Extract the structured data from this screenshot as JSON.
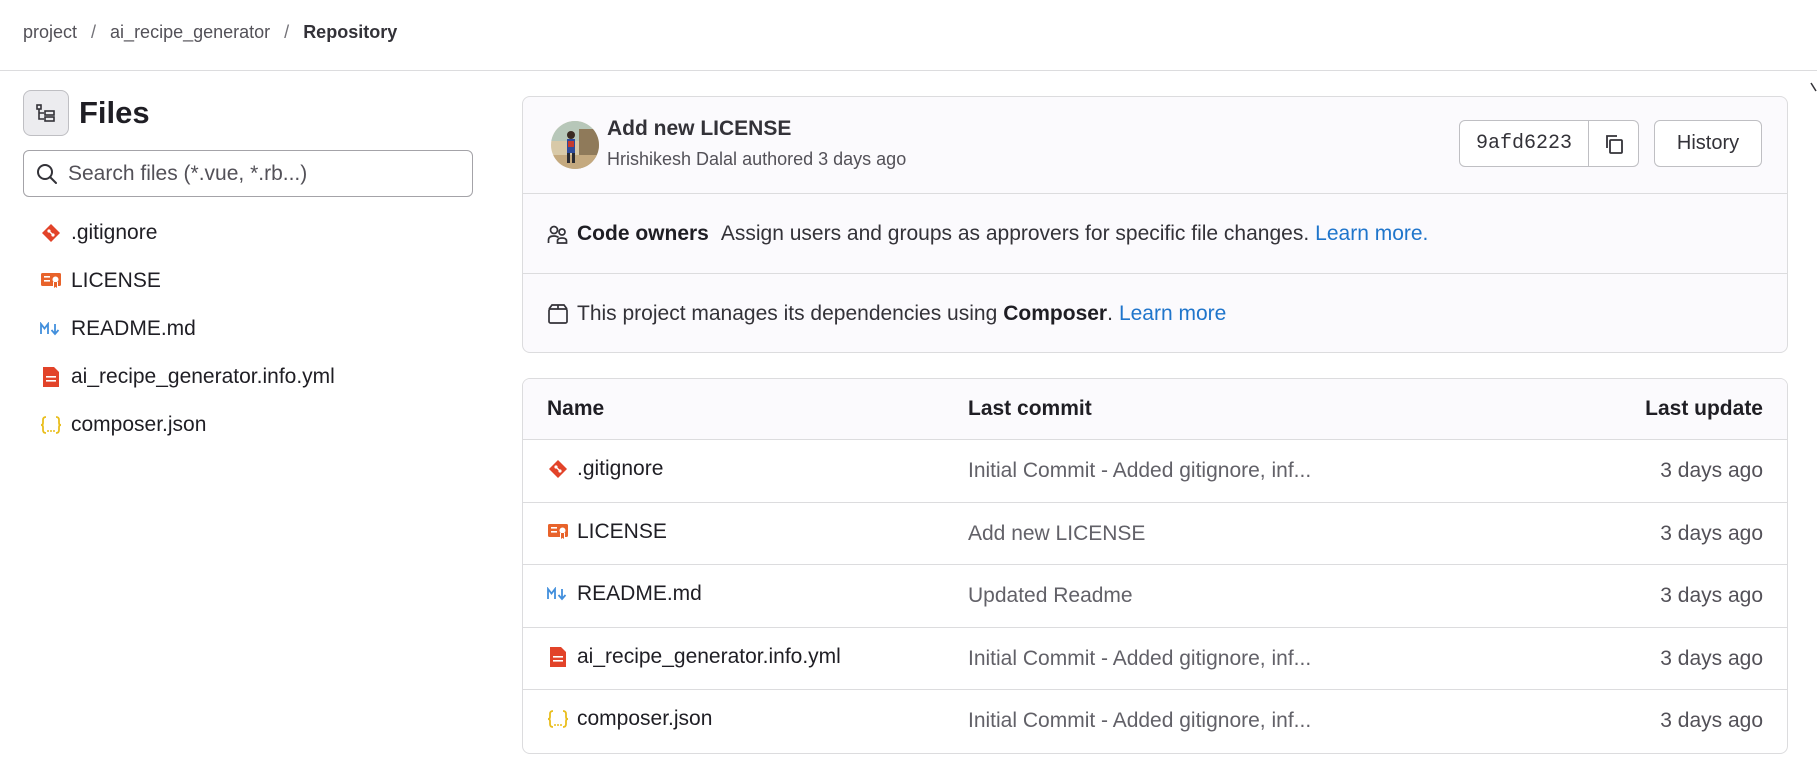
{
  "breadcrumb": {
    "items": [
      "project",
      "ai_recipe_generator",
      "Repository"
    ],
    "separator": "/"
  },
  "sidebar": {
    "title": "Files",
    "search": {
      "placeholder": "Search files (*.vue, *.rb...)",
      "value": ""
    },
    "files": [
      {
        "name": ".gitignore",
        "icon": "git-icon"
      },
      {
        "name": "LICENSE",
        "icon": "license-icon"
      },
      {
        "name": "README.md",
        "icon": "markdown-icon"
      },
      {
        "name": "ai_recipe_generator.info.yml",
        "icon": "yaml-file-icon"
      },
      {
        "name": "composer.json",
        "icon": "json-braces-icon"
      }
    ]
  },
  "commit": {
    "title": "Add new LICENSE",
    "author": "Hrishikesh Dalal",
    "action": "authored",
    "time": "3 days ago",
    "sha": "9afd6223",
    "history_label": "History"
  },
  "code_owners": {
    "label": "Code owners",
    "description": "Assign users and groups as approvers for specific file changes.",
    "link": "Learn more."
  },
  "dependencies": {
    "prefix": "This project manages its dependencies using",
    "manager": "Composer",
    "suffix": ".",
    "link": "Learn more"
  },
  "table": {
    "headers": {
      "name": "Name",
      "last_commit": "Last commit",
      "last_update": "Last update"
    },
    "rows": [
      {
        "name": ".gitignore",
        "icon": "git-icon",
        "commit": "Initial Commit - Added gitignore, inf...",
        "updated": "3 days ago"
      },
      {
        "name": "LICENSE",
        "icon": "license-icon",
        "commit": "Add new LICENSE",
        "updated": "3 days ago"
      },
      {
        "name": "README.md",
        "icon": "markdown-icon",
        "commit": "Updated Readme",
        "updated": "3 days ago"
      },
      {
        "name": "ai_recipe_generator.info.yml",
        "icon": "yaml-file-icon",
        "commit": "Initial Commit - Added gitignore, inf...",
        "updated": "3 days ago"
      },
      {
        "name": "composer.json",
        "icon": "json-braces-icon",
        "commit": "Initial Commit - Added gitignore, inf...",
        "updated": "3 days ago"
      }
    ]
  },
  "colors": {
    "link": "#1f75cb",
    "git": "#e24329",
    "license": "#e8632b",
    "markdown": "#428fdc",
    "yaml": "#e24329",
    "json": "#e9be1e"
  }
}
